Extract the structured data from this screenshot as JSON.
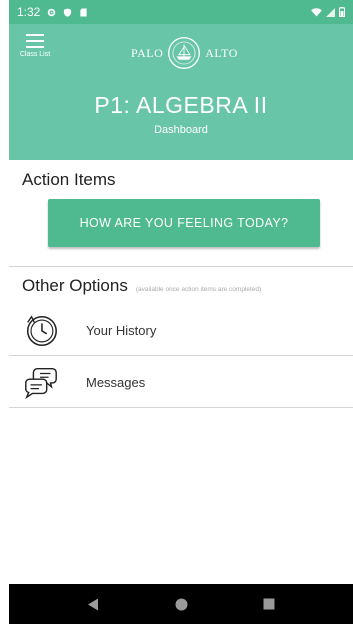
{
  "status_bar": {
    "time": "1:32",
    "icons": [
      "settings-icon",
      "shield-icon",
      "sd-card-icon",
      "wifi-icon",
      "signal-icon",
      "battery-icon"
    ]
  },
  "header": {
    "menu_label": "Class List",
    "logo_left": "PALO",
    "logo_right": "ALTO",
    "title": "P1: ALGEBRA II",
    "subtitle": "Dashboard"
  },
  "action_items": {
    "heading": "Action Items",
    "button_label": "HOW ARE YOU FEELING TODAY?"
  },
  "other_options": {
    "heading": "Other Options",
    "note": "(available once action items are completed)",
    "items": [
      {
        "label": "Your History",
        "icon": "history-clock-icon"
      },
      {
        "label": "Messages",
        "icon": "chat-bubbles-icon"
      }
    ]
  },
  "nav_bar": {
    "buttons": [
      "back-icon",
      "home-icon",
      "recents-icon"
    ]
  },
  "colors": {
    "status_bar": "#4fb990",
    "header": "#69c5a8",
    "button": "#4fb990",
    "nav_bar": "#000000"
  }
}
